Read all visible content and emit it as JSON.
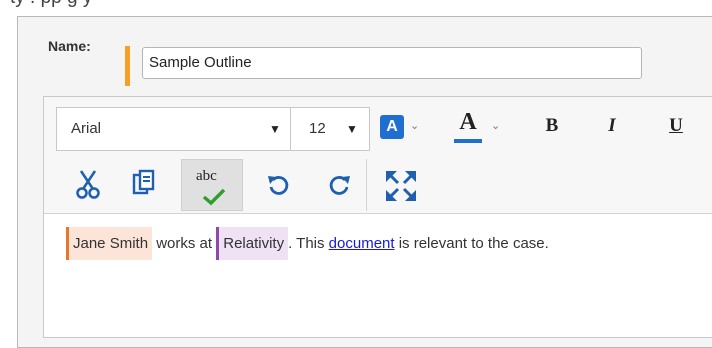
{
  "caption": "ty              .                          pp          g             y",
  "form": {
    "name_label": "Name:",
    "name_value": "Sample Outline"
  },
  "toolbar": {
    "font_family": "Arial",
    "font_size": "12",
    "highlight_icon": "A",
    "font_color_icon": "A",
    "bold": "B",
    "italic": "I",
    "underline": "U",
    "spell_label": "abc",
    "colors": {
      "accent_orange": "#f7a023",
      "highlight_blue": "#1f6fd1",
      "check_green": "#2e9e2e"
    }
  },
  "content": {
    "person": "Jane Smith",
    "text1": " works at ",
    "org": "Relativity",
    "text2": ". This ",
    "link": "document",
    "text3": " is relevant to the case."
  }
}
